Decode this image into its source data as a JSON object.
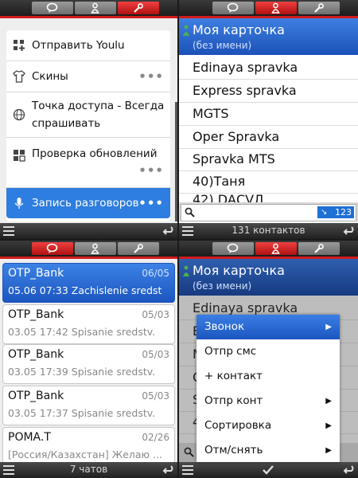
{
  "colors": {
    "accent": "#2e7de0",
    "active_tab": "#d21c1c",
    "badge": "#1e6fd6"
  },
  "top_left": {
    "tabs": [
      {
        "icon": "chat-icon",
        "active": false
      },
      {
        "icon": "contacts-icon",
        "active": false
      },
      {
        "icon": "wrench-icon",
        "active": true
      }
    ],
    "items": [
      {
        "label": "Отправить Youlu",
        "icon": "app-grid-icon",
        "dots": ""
      },
      {
        "label": "Скины",
        "icon": "shirt-icon",
        "dots": "•••"
      },
      {
        "label_line1": "Точка доступа - Всегда",
        "label_line2": "спрашивать",
        "icon": "globe-icon",
        "dots": ""
      },
      {
        "label": "Проверка обновлений",
        "icon": "update-grid-icon",
        "dots": "•••"
      },
      {
        "label": "Запись разговоров",
        "icon": "microphone-icon",
        "dots": "•••"
      }
    ]
  },
  "top_right": {
    "tabs": [
      {
        "icon": "chat-icon",
        "active": false
      },
      {
        "icon": "contacts-icon",
        "active": true
      },
      {
        "icon": "wrench-icon",
        "active": false
      }
    ],
    "my_card": {
      "title": "Моя карточка",
      "subtitle": "(без имени)"
    },
    "contacts": [
      "Edinaya spravka",
      "Express spravka",
      "MGTS",
      "Oper Spravka",
      "Spravka MTS",
      "40)Таня",
      "42) DАСVЛ"
    ],
    "search_count": "123",
    "status": "131 контактов"
  },
  "bottom_left": {
    "tabs": [
      {
        "icon": "chat-icon",
        "active": true
      },
      {
        "icon": "contacts-icon",
        "active": false
      },
      {
        "icon": "wrench-icon",
        "active": false
      }
    ],
    "messages": [
      {
        "name": "OTP_Bank",
        "date": "06/05",
        "preview": "05.06 07:33 Zachislenie sredst"
      },
      {
        "name": "OTP_Bank",
        "date": "05/03",
        "preview": "03.05 17:42 Spisanie sredstv."
      },
      {
        "name": "OTP_Bank",
        "date": "05/03",
        "preview": "03.05 17:39 Spisanie sredstv."
      },
      {
        "name": "OTP_Bank",
        "date": "05/03",
        "preview": "03.05 17:37 Spisanie sredstv."
      },
      {
        "name": "POMA.T",
        "date": "02/26",
        "preview": "[Россия/Казахстан] Желаю ..."
      }
    ],
    "status": "7 чатов"
  },
  "bottom_right": {
    "tabs": [
      {
        "icon": "chat-icon",
        "active": false
      },
      {
        "icon": "contacts-icon",
        "active": true
      },
      {
        "icon": "wrench-icon",
        "active": false
      }
    ],
    "my_card": {
      "title": "Моя карточка",
      "subtitle": "(без имени)"
    },
    "contacts": [
      "Edinaya spravka",
      "E",
      "M",
      "O",
      "S",
      "4"
    ],
    "menu": [
      {
        "label": "Звонок",
        "submenu": true
      },
      {
        "label": "Отпр смс",
        "submenu": false
      },
      {
        "label": "+ контакт",
        "submenu": false
      },
      {
        "label": "Отпр конт",
        "submenu": true
      },
      {
        "label": "Сортировка",
        "submenu": true
      },
      {
        "label": "Отм/снять",
        "submenu": true
      }
    ]
  }
}
